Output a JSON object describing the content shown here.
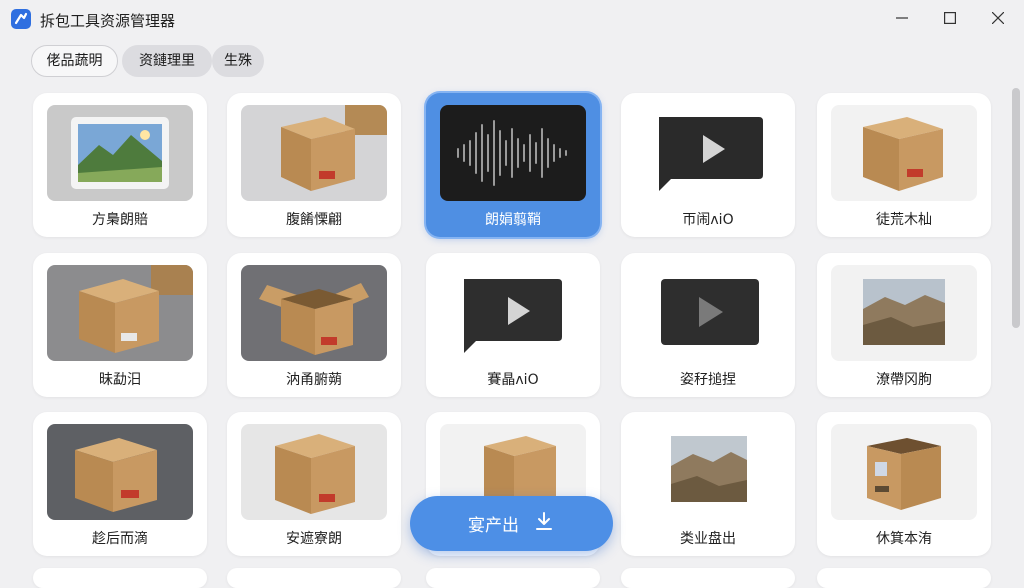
{
  "window": {
    "title": "拆包工具资源管理器"
  },
  "chips": [
    "佬品蔬明",
    "资鏈理里",
    "生殊"
  ],
  "cards": [
    {
      "label": "方梟朗賠",
      "thumb": "landscape-photo-frame"
    },
    {
      "label": "腹餚慄翩",
      "thumb": "cardboard-box"
    },
    {
      "label": "朗娟翦鞘",
      "thumb": "audio-waveform",
      "selected": true
    },
    {
      "label": "帀闹ʌiO",
      "thumb": "video-play"
    },
    {
      "label": "徒荒木杣",
      "thumb": "cardboard-box"
    },
    {
      "label": "昧勐汨",
      "thumb": "cardboard-box"
    },
    {
      "label": "汭甬腑蒴",
      "thumb": "open-cardboard-box"
    },
    {
      "label": "賽晶ʌiO",
      "thumb": "video-play"
    },
    {
      "label": "姿秄搥捏",
      "thumb": "video-play"
    },
    {
      "label": "潦帶冈朐",
      "thumb": "landscape-photo"
    },
    {
      "label": "趁后而滴",
      "thumb": "cardboard-box"
    },
    {
      "label": "安遮寮朗",
      "thumb": "cardboard-box"
    },
    {
      "label": "",
      "thumb": "cardboard-box"
    },
    {
      "label": "类业盘出",
      "thumb": "landscape-photo"
    },
    {
      "label": "休箕本洧",
      "thumb": "open-cardboard-box"
    }
  ],
  "export_button": {
    "label": "宴产出",
    "icon": "download-icon"
  },
  "colors": {
    "accent": "#4d8fe6",
    "selected_card": "#4f8fe3",
    "background": "#f0f0f2"
  }
}
